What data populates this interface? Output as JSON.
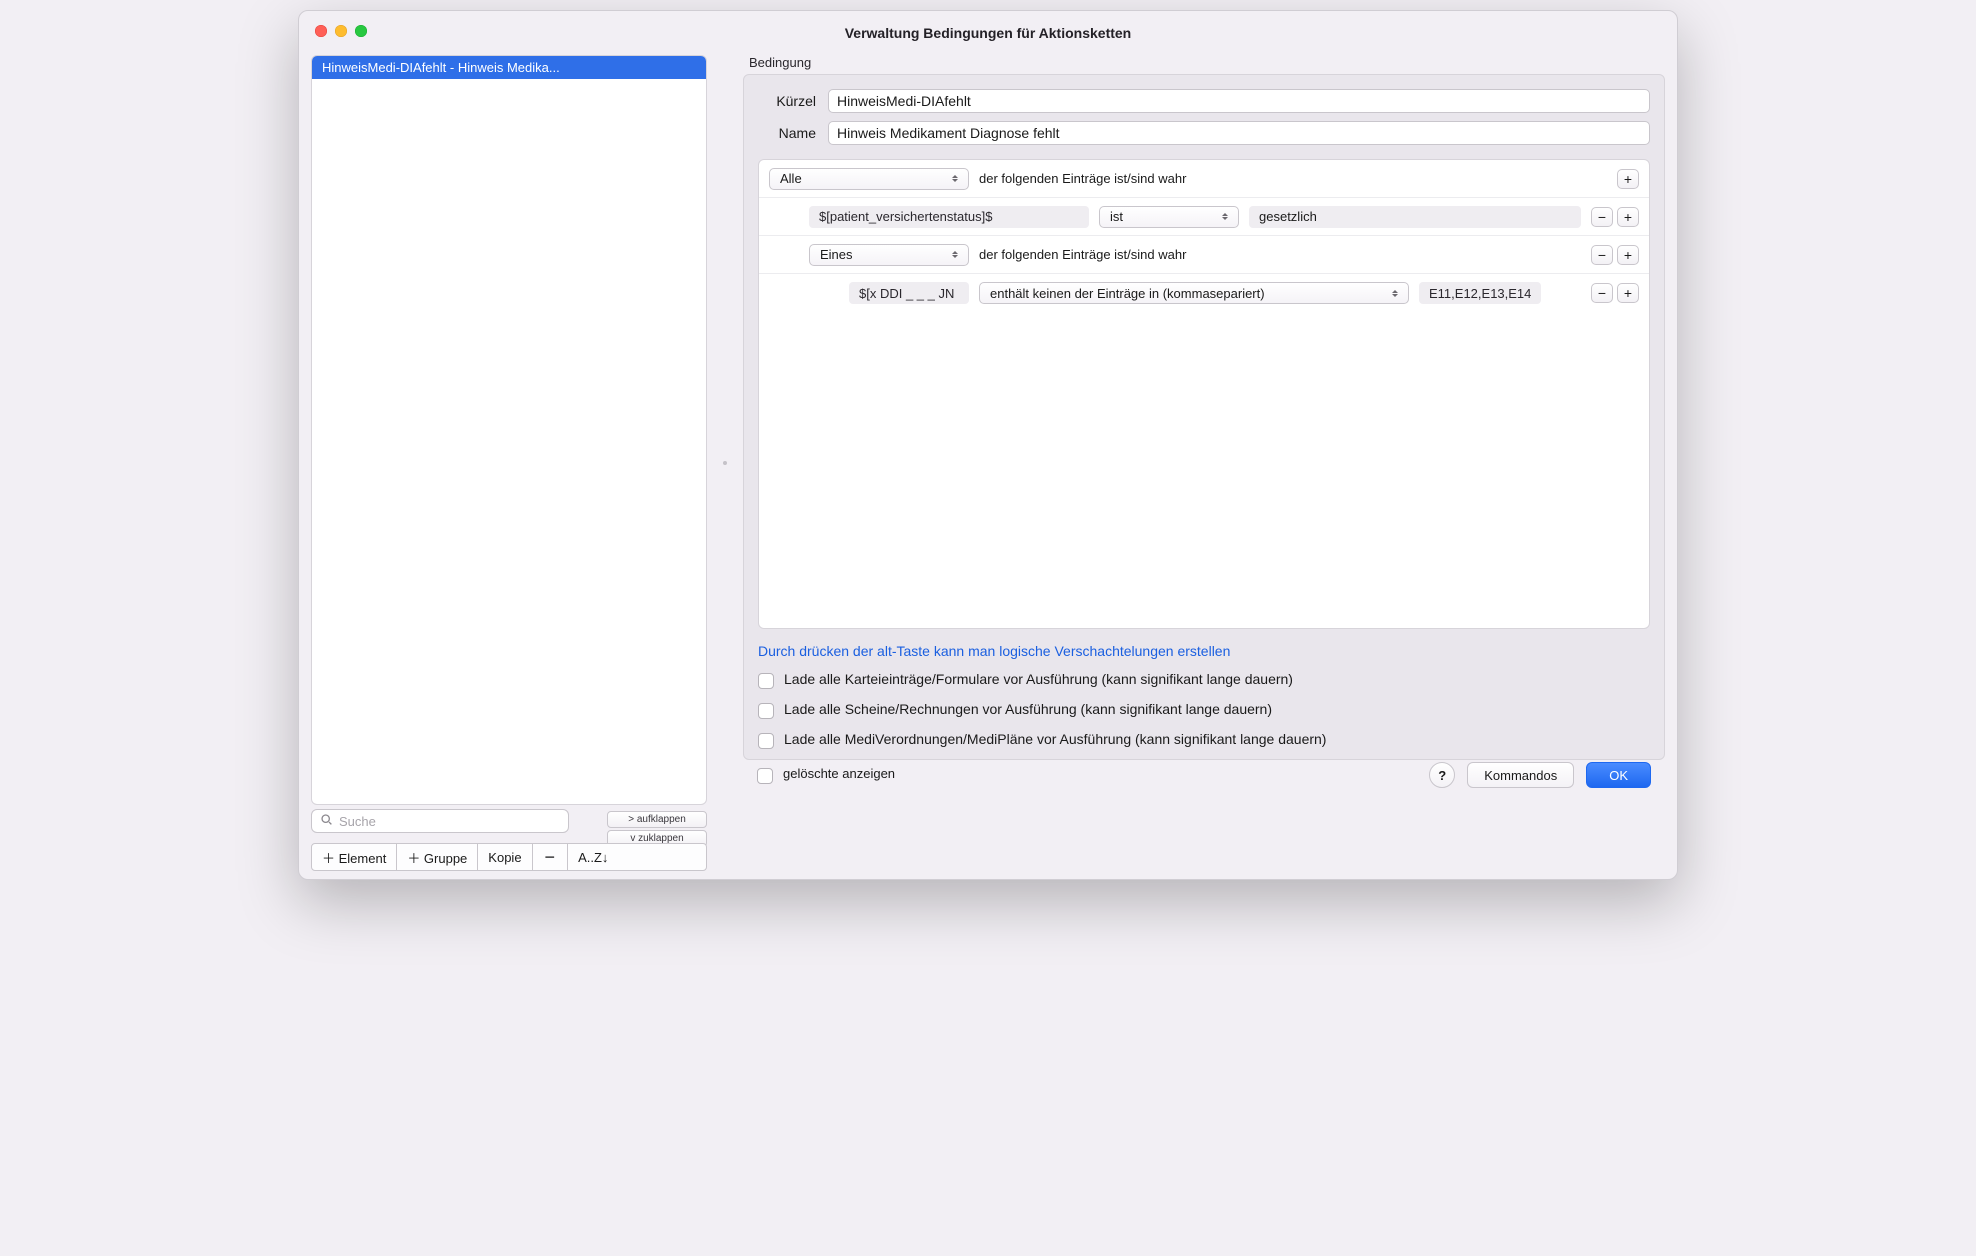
{
  "window": {
    "title": "Verwaltung Bedingungen für Aktionsketten"
  },
  "sidebar": {
    "items": [
      {
        "label": "HinweisMedi-DIAfehlt - Hinweis Medika...",
        "selected": true
      }
    ],
    "search_placeholder": "Suche",
    "expand_label": ">  aufklappen",
    "collapse_label": "v  zuklappen",
    "toolbar": {
      "add_element": "＋ Element",
      "add_group": "＋ Gruppe",
      "copy": "Kopie",
      "delete": "−",
      "sort": "A..Z↓"
    }
  },
  "section_label": "Bedingung",
  "form": {
    "kuerzel_label": "Kürzel",
    "kuerzel_value": "HinweisMedi-DIAfehlt",
    "name_label": "Name",
    "name_value": "Hinweis Medikament Diagnose fehlt"
  },
  "conditions": {
    "root": {
      "quantifier": "Alle",
      "tail": "der folgenden Einträge ist/sind wahr"
    },
    "row1": {
      "variable": "$[patient_versichertenstatus]$",
      "operator": "ist",
      "value": "gesetzlich"
    },
    "group2": {
      "quantifier": "Eines",
      "tail": "der folgenden Einträge ist/sind wahr"
    },
    "row2": {
      "variable": "$[x DDI _ _ _ JN",
      "operator": "enthält keinen der Einträge in (kommasepariert)",
      "value": "E11,E12,E13,E14"
    }
  },
  "hint": "Durch drücken der alt-Taste kann man logische Verschachtelungen erstellen",
  "checks": {
    "c1": "Lade alle Karteieinträge/Formulare vor Ausführung (kann signifikant lange dauern)",
    "c2": "Lade alle Scheine/Rechnungen vor Ausführung (kann signifikant lange dauern)",
    "c3": "Lade alle MediVerordnungen/MediPläne vor Ausführung (kann signifikant lange dauern)"
  },
  "bottom": {
    "show_deleted": "gelöschte anzeigen",
    "help": "?",
    "commands": "Kommandos",
    "ok": "OK"
  }
}
